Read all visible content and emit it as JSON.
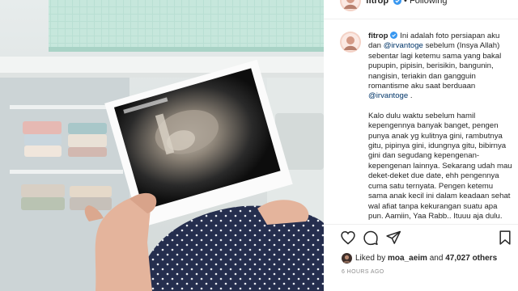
{
  "header": {
    "username": "fitrop",
    "separator": "•",
    "follow_status": "Following"
  },
  "caption": {
    "username": "fitrop",
    "line1_text": "Ini adalah foto persiapan aku dan",
    "mention1": "@irvantoge",
    "line1_rest": "sebelum (Insya Allah) sebentar lagi ketemu sama yang bakal pupupin, pipisin, berisikin, bangunin, nangisin, teriakin dan gangguin romantisme aku saat berduaan",
    "mention2": "@irvantoge",
    "line1_end": ".",
    "paragraph2": "Kalo dulu waktu sebelum hamil kepengennya banyak banget, pengen punya anak yg kulitnya gini, rambutnya gitu, pipinya gini, idungnya gitu, bibirnya gini dan segudang kepengenan-kepengenan lainnya. Sekarang udah mau deket-deket due date, ehh pengennya cuma satu ternyata. Pengen ketemu sama anak kecil ini dalam keadaan sehat wal afiat tanpa kekurangan suatu apa pun. Aamiin, Yaa Rabb.. Ituuu aja dulu."
  },
  "likes": {
    "prefix": "Liked by",
    "user": "moa_aeim",
    "connector": "and",
    "count": "47,027 others"
  },
  "timestamp": "6 HOURS AGO",
  "icons": {
    "like": "heart-icon",
    "comment": "comment-icon",
    "share": "share-icon",
    "save": "bookmark-icon",
    "verified": "verified-badge-icon"
  },
  "colors": {
    "verified_blue": "#3897f0",
    "mention": "#003569",
    "muted": "#8e8e8e"
  }
}
